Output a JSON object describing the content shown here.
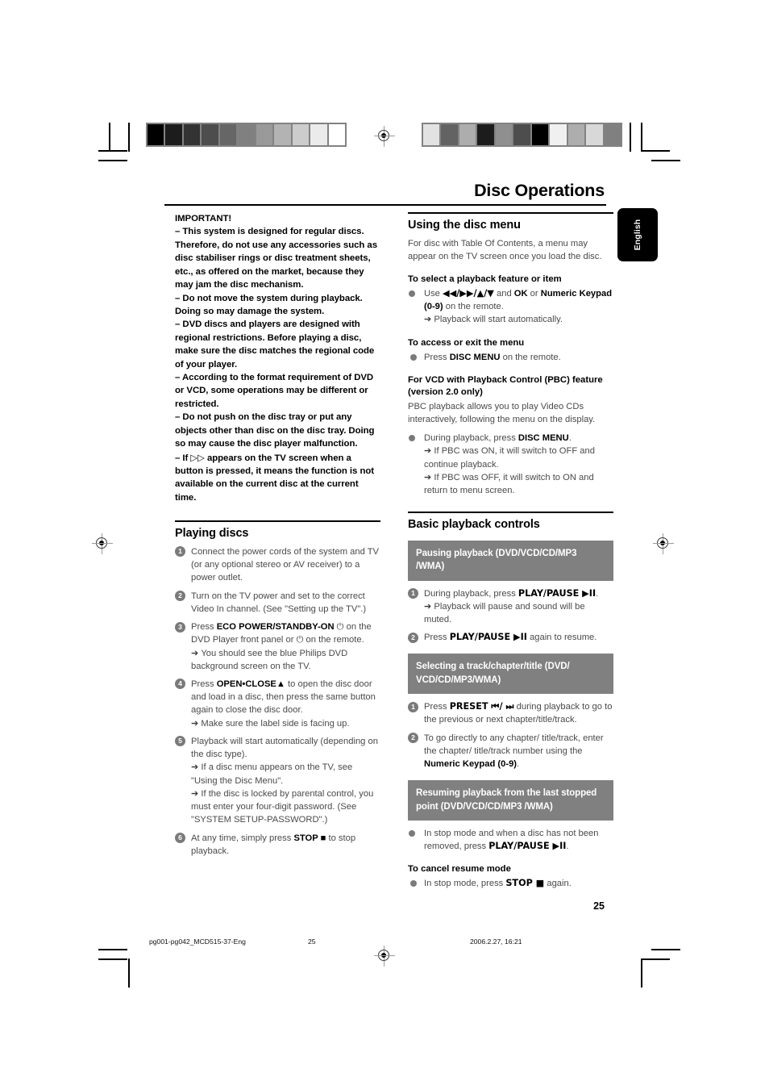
{
  "document": {
    "page_title": "Disc Operations",
    "language_tab": "English",
    "page_number": "25"
  },
  "footer": {
    "filename": "pg001-pg042_MCD515-37-Eng",
    "page": "25",
    "timestamp": "2006.2.27, 16:21"
  },
  "calibration": {
    "left_strip": [
      "#000000",
      "#1c1c1c",
      "#333333",
      "#4d4d4d",
      "#666666",
      "#808080",
      "#999999",
      "#b3b3b3",
      "#cccccc",
      "#ebebeb",
      "#ffffff"
    ],
    "right_strip": [
      "#e2e2e2",
      "#636363",
      "#adadad",
      "#1c1c1c",
      "#8f8f8f",
      "#4d4d4d",
      "#000000",
      "#f0f0f0",
      "#adadad",
      "#d8d8d8",
      "#808080"
    ]
  },
  "left_column": {
    "important": {
      "heading": "IMPORTANT!",
      "items": [
        "–   This system is designed for regular discs. Therefore, do not use any accessories such as disc stabiliser rings or disc treatment sheets, etc., as offered on the market, because they may jam the disc mechanism.",
        "–   Do not move the system during playback. Doing so may damage the system.",
        "–   DVD discs and players are designed with regional restrictions. Before playing a disc, make sure the disc matches the regional code of your player.",
        "–   According to the format requirement of DVD or VCD, some operations may be different or restricted.",
        "–   Do not push on the disc tray or put any objects other than disc on the disc tray. Doing so may cause the disc player malfunction."
      ],
      "last_item_prefix": "–   If",
      "last_item_suffix": "appears on the TV screen when a button is pressed, it means the function is not available on the current disc at the current time."
    },
    "playing_discs": {
      "heading": "Playing discs",
      "steps": [
        {
          "num": "1",
          "text": "Connect the power cords of the system and TV (or any optional stereo or AV receiver) to a power outlet.",
          "notes": []
        },
        {
          "num": "2",
          "text": "Turn on the TV power and set to the correct Video In channel. (See \"Setting up the TV\".)",
          "notes": []
        },
        {
          "num": "3",
          "text_pre": "Press ",
          "text_bold": "ECO POWER/STANDBY-ON",
          "text_post": " ⏻ on the DVD Player front panel or ⏻ on the remote.",
          "notes": [
            "You should see the blue Philips DVD background screen on the TV."
          ]
        },
        {
          "num": "4",
          "text_pre": "Press ",
          "text_bold": "OPEN•CLOSE▲",
          "text_post": "  to open the disc door and load in a disc, then press the same button again to close the disc door.",
          "notes": [
            "Make sure the label side is facing up."
          ]
        },
        {
          "num": "5",
          "text": "Playback will start automatically (depending on the disc type).",
          "notes": [
            "If a disc menu appears on the TV, see \"Using the Disc Menu\".",
            "If the disc is locked by parental control, you must enter your four-digit password. (See \"SYSTEM SETUP-PASSWORD\".)"
          ]
        },
        {
          "num": "6",
          "text_pre": "At any time, simply press ",
          "text_bold": "STOP ■",
          "text_post": " to stop playback.",
          "notes": []
        }
      ]
    }
  },
  "right_column": {
    "disc_menu": {
      "heading": "Using the disc menu",
      "intro": "For disc with Table Of Contents, a menu may appear on the TV screen once you load the disc.",
      "sub1": {
        "heading": "To select a playback feature or item",
        "line_pre": "Use ",
        "line_bold1": "◀◀/▶▶/▲/▼",
        "line_mid": "  and ",
        "line_bold2": "OK",
        "line_mid2": " or ",
        "line_bold3": "Numeric Keypad (0-9)",
        "line_post": " on the remote.",
        "note": "Playback will start automatically."
      },
      "sub2": {
        "heading": "To access or exit the menu",
        "line_pre": "Press ",
        "line_bold": "DISC MENU",
        "line_post": " on the remote."
      },
      "sub3": {
        "heading": "For VCD with Playback Control (PBC) feature (version 2.0 only)",
        "intro": "PBC playback allows you to play Video CDs interactively, following the menu on the display.",
        "line_pre": "During playback, press ",
        "line_bold": "DISC MENU",
        "line_post": ".",
        "notes": [
          "If PBC was ON, it will switch to OFF and continue playback.",
          "If PBC was OFF, it will switch to ON and return to menu screen."
        ]
      }
    },
    "basic_controls": {
      "heading": "Basic playback controls",
      "blocks": [
        {
          "banner": "Pausing playback (DVD/VCD/CD/MP3 /WMA)",
          "steps": [
            {
              "num": "1",
              "text_pre": "During playback, press ",
              "text_bold": "PLAY/PAUSE ▶II",
              "text_post": ".",
              "notes": [
                "Playback will pause and sound will be muted."
              ]
            },
            {
              "num": "2",
              "text_pre": "Press ",
              "text_bold": "PLAY/PAUSE ▶II",
              "text_post": " again to resume.",
              "notes": []
            }
          ]
        },
        {
          "banner": "Selecting a track/chapter/title (DVD/ VCD/CD/MP3/WMA)",
          "steps": [
            {
              "num": "1",
              "text_pre": "Press ",
              "text_bold": "PRESET ⏮/ ⏭",
              "text_post": "  during playback to go to the previous or next chapter/title/track.",
              "notes": []
            },
            {
              "num": "2",
              "text_pre": "To go directly to any chapter/ title/track, enter the chapter/ title/track number using the ",
              "text_bold": "Numeric Keypad (0-9)",
              "text_post": ".",
              "notes": []
            }
          ]
        },
        {
          "banner": "Resuming playback from the last stopped point (DVD/VCD/CD/MP3 /WMA)",
          "bullet": {
            "text_pre": "In stop mode and when a disc has not been removed, press ",
            "text_bold": "PLAY/PAUSE ▶II",
            "text_post": "."
          }
        }
      ],
      "cancel_resume": {
        "heading": "To cancel resume mode",
        "text_pre": "In stop mode, press ",
        "text_bold": "STOP ■",
        "text_post": " again."
      }
    }
  }
}
